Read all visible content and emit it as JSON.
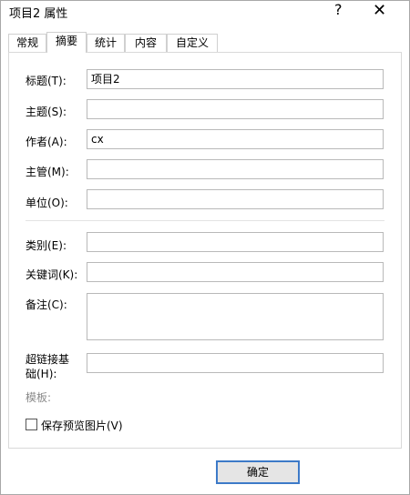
{
  "window": {
    "title": "项目2 属性",
    "help_label": "?",
    "close_label": "✕"
  },
  "tabs": [
    {
      "label": "常规",
      "active": false
    },
    {
      "label": "摘要",
      "active": true
    },
    {
      "label": "统计",
      "active": false
    },
    {
      "label": "内容",
      "active": false
    },
    {
      "label": "自定义",
      "active": false
    }
  ],
  "form": {
    "title_label": "标题(T):",
    "title_value": "项目2",
    "subject_label": "主题(S):",
    "subject_value": "",
    "author_label": "作者(A):",
    "author_value": "cx",
    "manager_label": "主管(M):",
    "manager_value": "",
    "company_label": "单位(O):",
    "company_value": "",
    "category_label": "类别(E):",
    "category_value": "",
    "keywords_label": "关键词(K):",
    "keywords_value": "",
    "comments_label": "备注(C):",
    "comments_value": "",
    "hyperlink_label_line1": "超链接基",
    "hyperlink_label_line2": "础(H):",
    "hyperlink_value": "",
    "template_label": "模板:",
    "save_preview_label": "保存预览图片(V)",
    "save_preview_checked": false
  },
  "buttons": {
    "ok_label": "确定"
  }
}
